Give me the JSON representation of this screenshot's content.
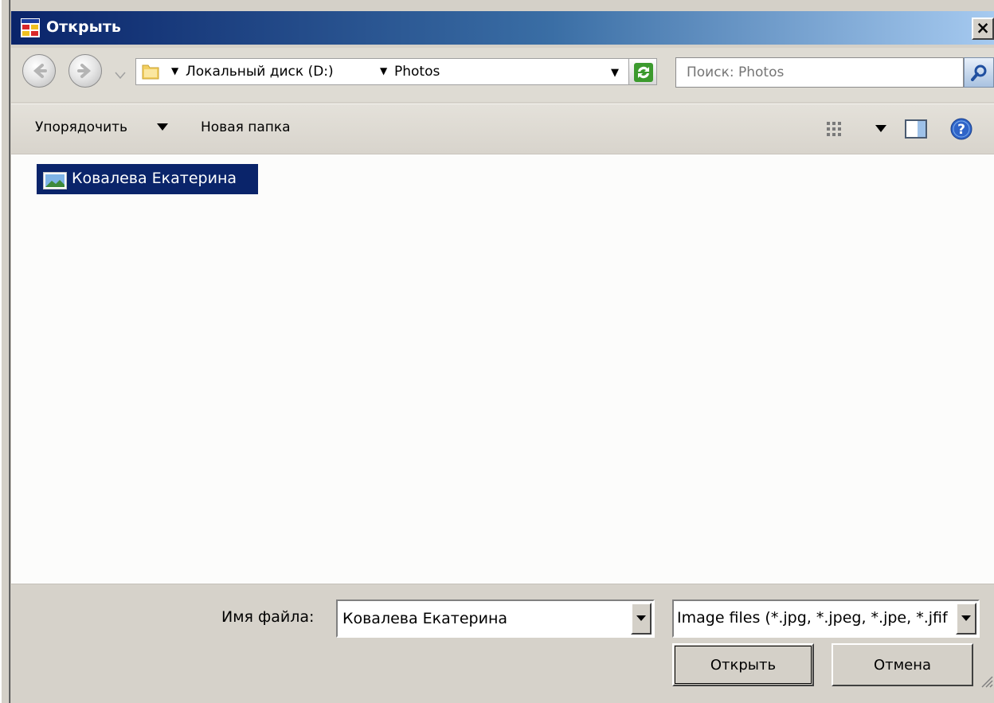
{
  "window": {
    "title": "Открыть",
    "close_symbol": "×",
    "icon": "app-window-icon"
  },
  "navigation": {
    "back_icon": "back-arrow-icon",
    "forward_icon": "forward-arrow-icon",
    "breadcrumb": [
      "Локальный диск (D:)",
      "Photos"
    ],
    "refresh_icon": "refresh-icon",
    "search_placeholder": "Поиск: Photos",
    "search_icon": "magnifier-icon"
  },
  "toolbar": {
    "organize_label": "Упорядочить",
    "new_folder_label": "Новая папка",
    "view_icon": "view-options-icon",
    "preview_pane_icon": "preview-pane-icon",
    "help_icon": "help-icon"
  },
  "files": [
    {
      "name": "Ковалева Екатерина",
      "icon": "image-file-icon",
      "selected": true
    }
  ],
  "bottom": {
    "filename_label": "Имя файла:",
    "filename_value": "Ковалева Екатерина",
    "filetype_value": "Image files (*.jpg, *.jpeg, *.jpe, *.jfif, *.png)",
    "open_button": "Открыть",
    "cancel_button": "Отмена"
  },
  "colors": {
    "title_gradient_start": "#0a246a",
    "title_gradient_end": "#a6caf0",
    "selection": "#0a246a",
    "dialog_face": "#d4d0c8"
  }
}
